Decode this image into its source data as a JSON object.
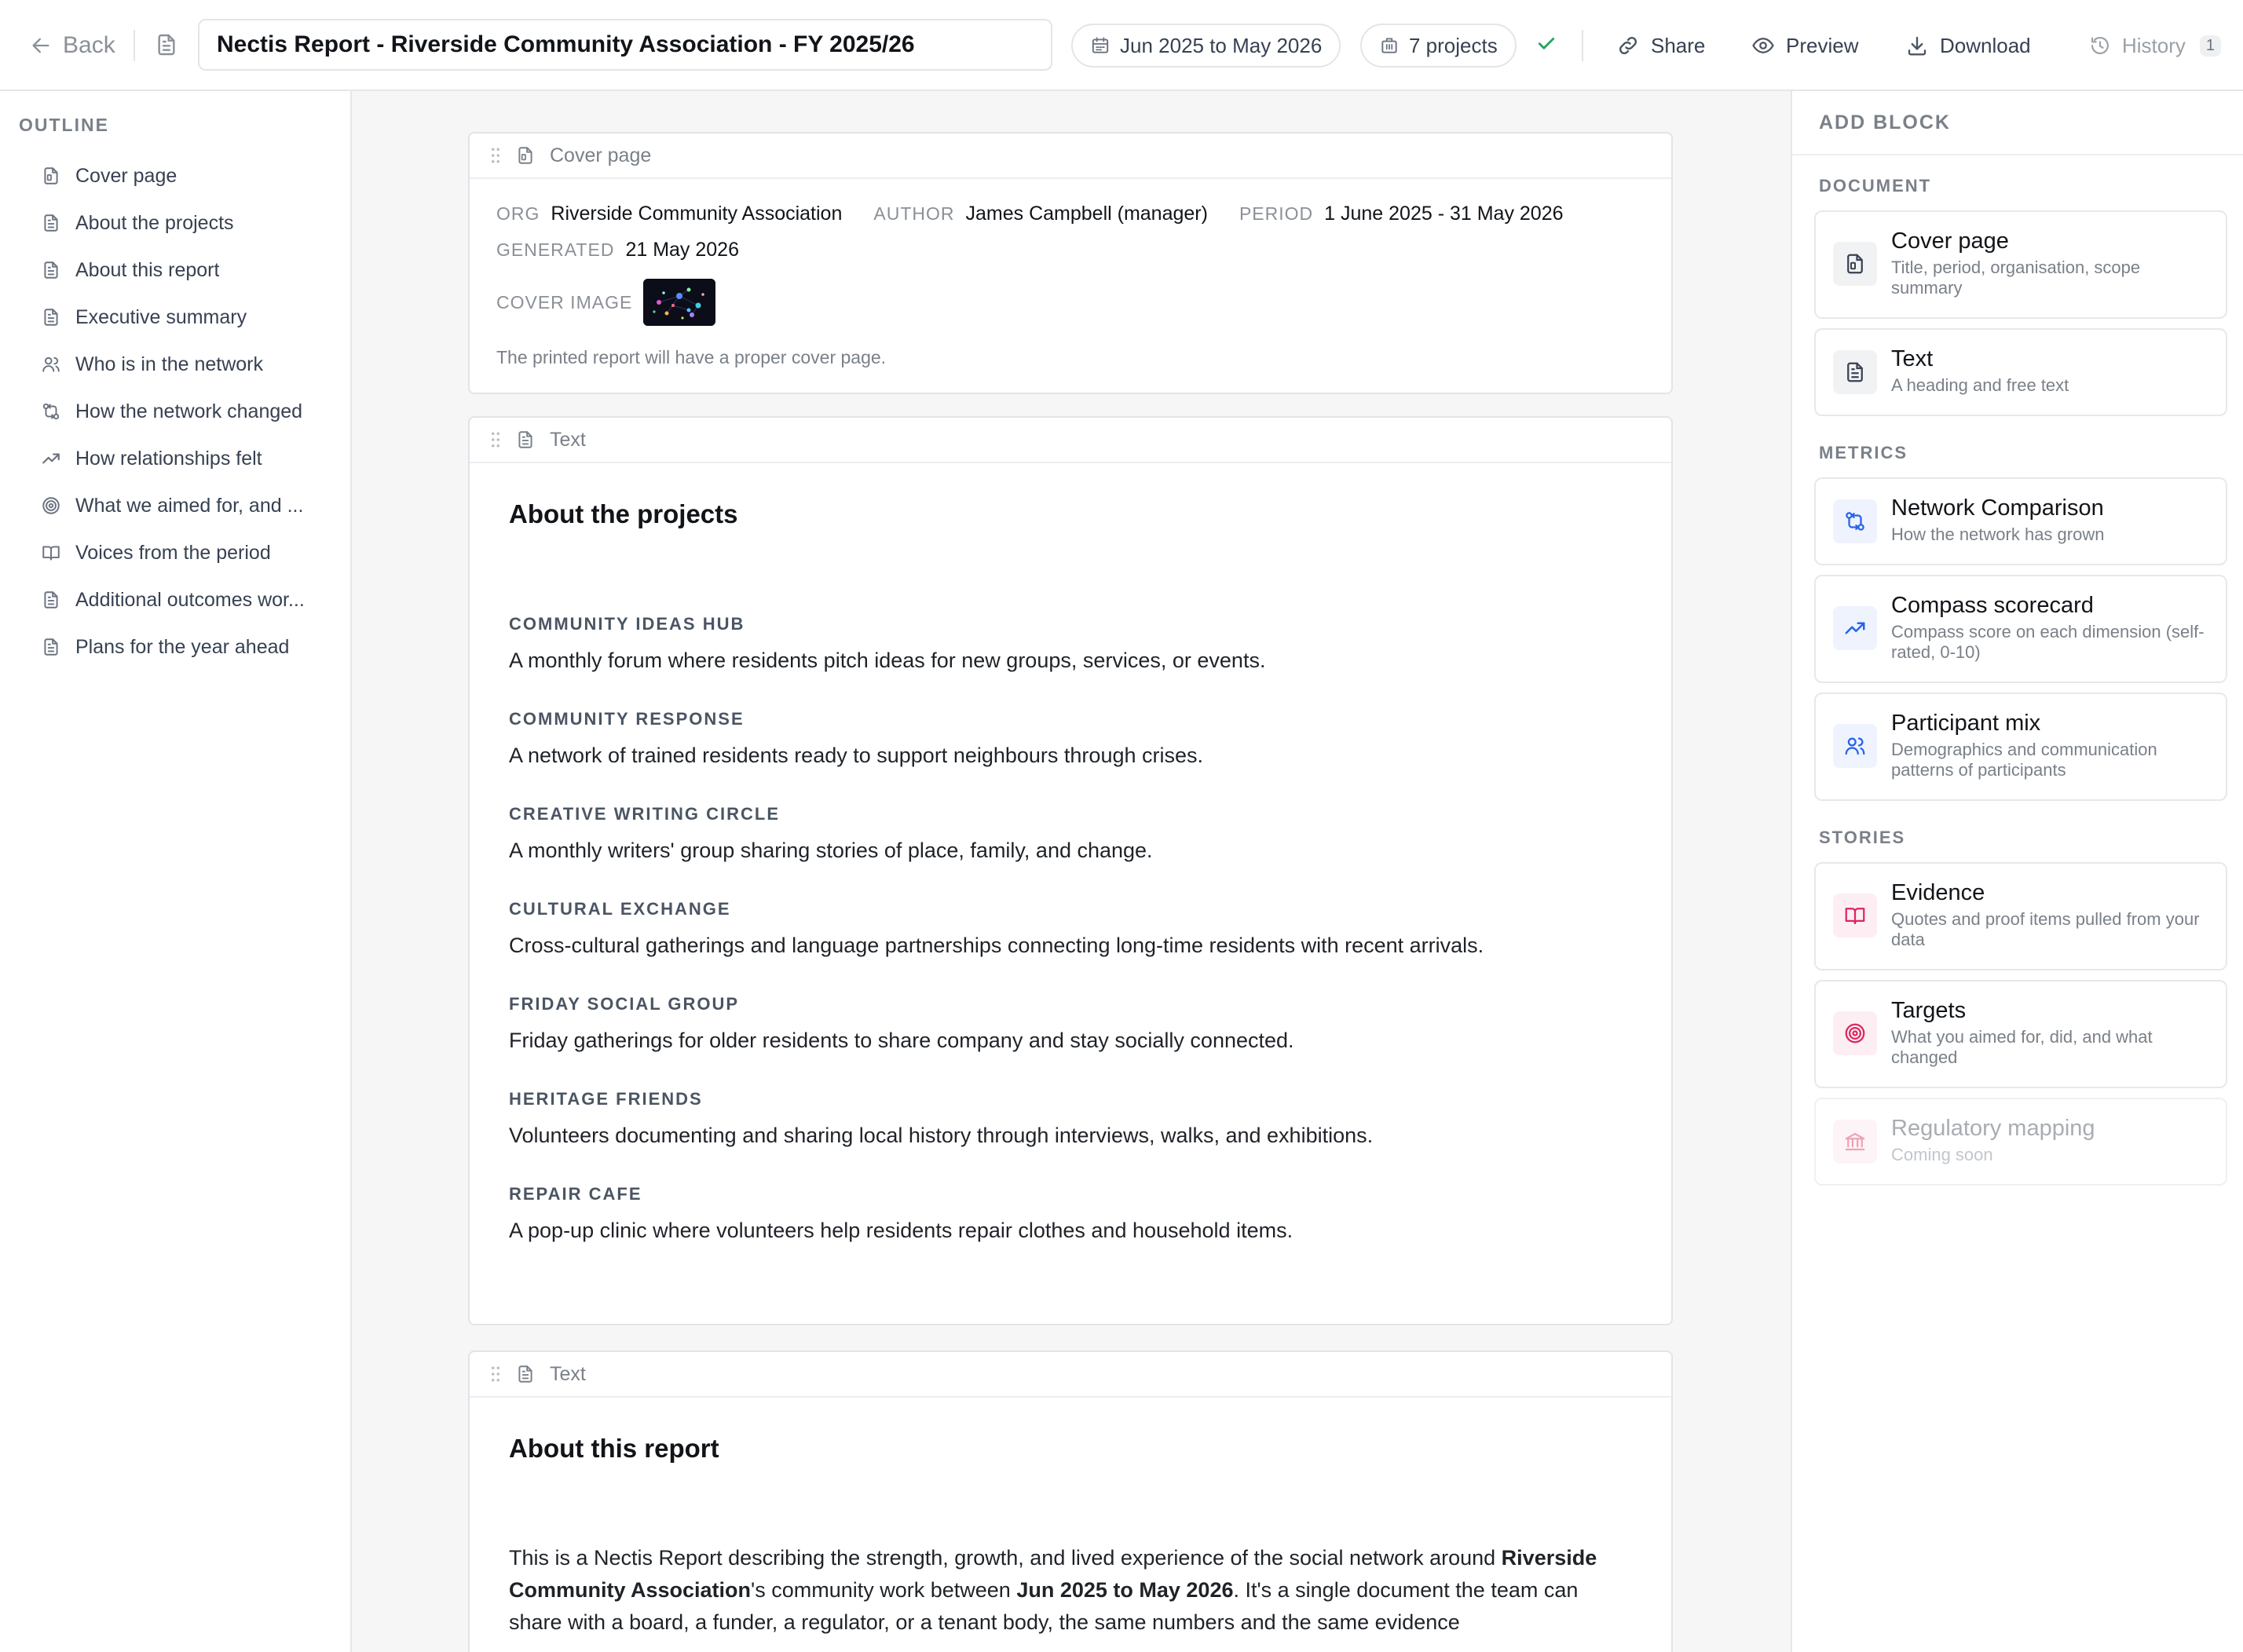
{
  "topbar": {
    "back_label": "Back",
    "title_value": "Nectis Report - Riverside Community Association - FY 2025/26",
    "period_label": "Jun 2025 to May 2026",
    "projects_label": "7 projects",
    "share_label": "Share",
    "preview_label": "Preview",
    "download_label": "Download",
    "history_label": "History",
    "history_count": "1"
  },
  "outline": {
    "title": "OUTLINE",
    "items": [
      {
        "label": "Cover page",
        "icon": "cover-doc-icon"
      },
      {
        "label": "About the projects",
        "icon": "document-icon"
      },
      {
        "label": "About this report",
        "icon": "document-icon"
      },
      {
        "label": "Executive summary",
        "icon": "document-icon"
      },
      {
        "label": "Who is in the network",
        "icon": "people-icon"
      },
      {
        "label": "How the network changed",
        "icon": "network-compare-icon"
      },
      {
        "label": "How relationships felt",
        "icon": "trend-up-icon"
      },
      {
        "label": "What we aimed for, and ...",
        "icon": "target-icon"
      },
      {
        "label": "Voices from the period",
        "icon": "book-icon"
      },
      {
        "label": "Additional outcomes wor...",
        "icon": "document-icon"
      },
      {
        "label": "Plans for the year ahead",
        "icon": "document-icon"
      }
    ]
  },
  "cover": {
    "block_label": "Cover page",
    "org_label": "ORG",
    "org_value": "Riverside Community Association",
    "author_label": "AUTHOR",
    "author_value": "James Campbell (manager)",
    "period_label": "PERIOD",
    "period_value": "1 June 2025 - 31 May 2026",
    "generated_label": "GENERATED",
    "generated_value": "21 May 2026",
    "cover_image_label": "COVER IMAGE",
    "note": "The printed report will have a proper cover page."
  },
  "projects_block": {
    "block_label": "Text",
    "heading": "About the projects",
    "projects": [
      {
        "name": "COMMUNITY IDEAS HUB",
        "desc": "A monthly forum where residents pitch ideas for new groups, services, or events."
      },
      {
        "name": "COMMUNITY RESPONSE",
        "desc": "A network of trained residents ready to support neighbours through crises."
      },
      {
        "name": "CREATIVE WRITING CIRCLE",
        "desc": "A monthly writers' group sharing stories of place, family, and change."
      },
      {
        "name": "CULTURAL EXCHANGE",
        "desc": "Cross-cultural gatherings and language partnerships connecting long-time residents with recent arrivals."
      },
      {
        "name": "FRIDAY SOCIAL GROUP",
        "desc": "Friday gatherings for older residents to share company and stay socially connected."
      },
      {
        "name": "HERITAGE FRIENDS",
        "desc": "Volunteers documenting and sharing local history through interviews, walks, and exhibitions."
      },
      {
        "name": "REPAIR CAFE",
        "desc": "A pop-up clinic where volunteers help residents repair clothes and household items."
      }
    ]
  },
  "report_block": {
    "block_label": "Text",
    "heading": "About this report",
    "p1": "This is a Nectis Report describing the strength, growth, and lived experience of the social network around ",
    "org": "Riverside Community Association",
    "p2": "'s community work between ",
    "period": "Jun 2025 to May 2026",
    "p3": ". It's a single document the team can share with a board, a funder, a regulator, or a tenant body, the same numbers and the same evidence"
  },
  "addblock": {
    "title": "ADD BLOCK",
    "sections": {
      "document": "DOCUMENT",
      "metrics": "METRICS",
      "stories": "STORIES"
    },
    "cards": [
      {
        "name": "Cover page",
        "desc": "Title, period, organisation, scope summary",
        "icon": "cover-doc-icon",
        "color": "#374151"
      },
      {
        "name": "Text",
        "desc": "A heading and free text",
        "icon": "document-icon",
        "color": "#374151"
      },
      {
        "name": "Network Comparison",
        "desc": "How the network has grown",
        "icon": "network-compare-icon",
        "color": "#2563eb"
      },
      {
        "name": "Compass scorecard",
        "desc": "Compass score on each dimension (self-rated, 0-10)",
        "icon": "trend-up-icon",
        "color": "#2563eb"
      },
      {
        "name": "Participant mix",
        "desc": "Demographics and communication patterns of participants",
        "icon": "people-icon",
        "color": "#2563eb"
      },
      {
        "name": "Evidence",
        "desc": "Quotes and proof items pulled from your data",
        "icon": "book-icon",
        "color": "#db2760"
      },
      {
        "name": "Targets",
        "desc": "What you aimed for, did, and what changed",
        "icon": "target-icon",
        "color": "#db2760"
      },
      {
        "name": "Regulatory mapping",
        "desc": "Coming soon",
        "icon": "bank-icon",
        "color": "#f0a3b8"
      }
    ]
  },
  "colors": {
    "accent_blue": "#2563eb",
    "accent_pink": "#db2760",
    "check_green": "#22a35a"
  }
}
